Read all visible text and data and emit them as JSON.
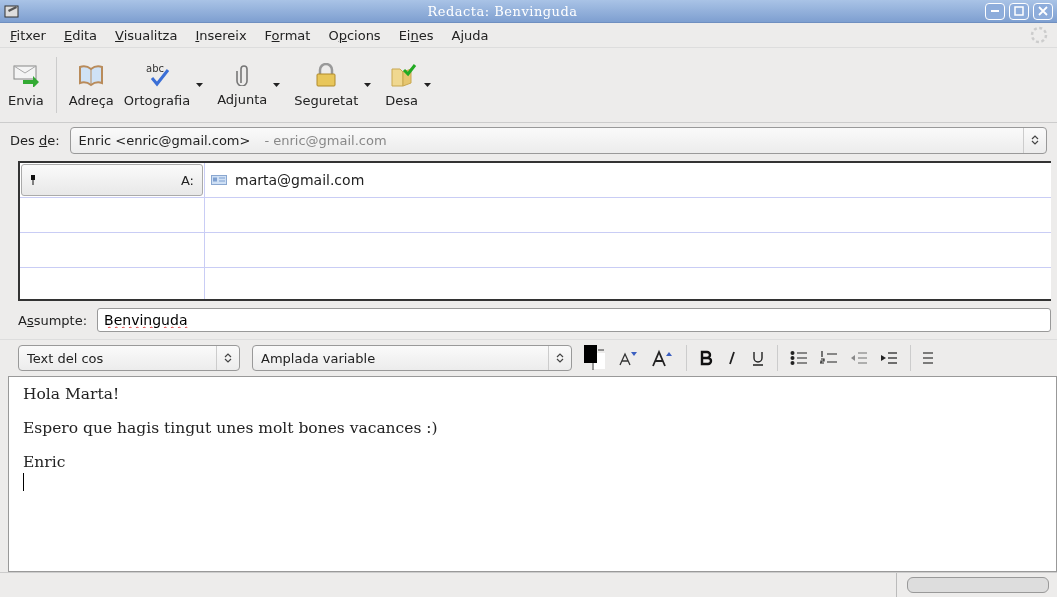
{
  "window": {
    "title": "Redacta: Benvinguda"
  },
  "menu": [
    {
      "label": "Fitxer"
    },
    {
      "label": "Edita"
    },
    {
      "label": "Visualitza"
    },
    {
      "label": "Insereix"
    },
    {
      "label": "Format"
    },
    {
      "label": "Opcions"
    },
    {
      "label": "Eines"
    },
    {
      "label": "Ajuda"
    }
  ],
  "toolbar": [
    {
      "kind": "send",
      "label": "Envia",
      "dropdown": false
    },
    {
      "kind": "address",
      "label": "Adreça",
      "dropdown": false
    },
    {
      "kind": "spell",
      "label": "Ortografia",
      "icon_text": "abc",
      "dropdown": true
    },
    {
      "kind": "attach",
      "label": "Adjunta",
      "dropdown": true
    },
    {
      "kind": "security",
      "label": "Seguretat",
      "dropdown": true
    },
    {
      "kind": "save",
      "label": "Desa",
      "dropdown": true
    }
  ],
  "from": {
    "label": "Des de:",
    "value": "Enric <enric@gmail.com>",
    "account": "- enric@gmail.com"
  },
  "recipients": [
    {
      "type": "A:",
      "address": "marta@gmail.com"
    }
  ],
  "subject": {
    "label": "Assumpte:",
    "value": "Benvinguda"
  },
  "format_bar": {
    "paragraph_style": "Text del cos",
    "font": "Amplada variable"
  },
  "status_bar": {
    "progress": {
      "level": 0
    }
  },
  "body": [
    "Hola Marta!",
    "Espero que hagis tingut unes molt bones vacances :)",
    "Enric"
  ]
}
